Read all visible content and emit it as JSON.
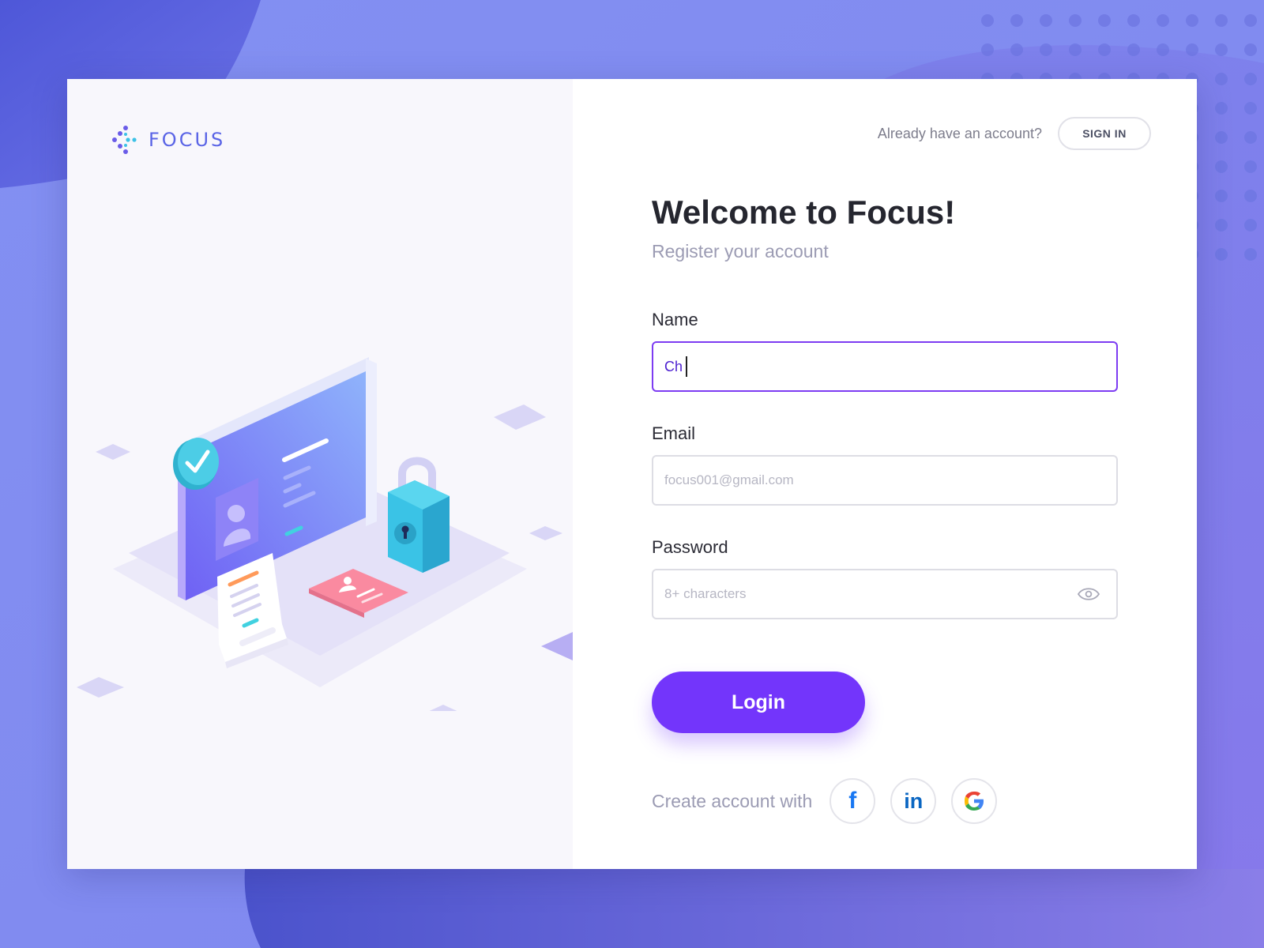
{
  "brand": {
    "name": "FOCUS"
  },
  "header": {
    "already_text": "Already have an account?",
    "signin_label": "SIGN IN"
  },
  "form": {
    "title": "Welcome to Focus!",
    "subtitle": "Register your account",
    "name_label": "Name",
    "name_value": "Ch",
    "email_label": "Email",
    "email_placeholder": "focus001@gmail.com",
    "password_label": "Password",
    "password_placeholder": "8+ characters",
    "login_label": "Login"
  },
  "social": {
    "prompt": "Create account with",
    "providers": [
      {
        "icon": "facebook-icon",
        "glyph": "f",
        "color": "#1877f2"
      },
      {
        "icon": "linkedin-icon",
        "glyph": "in",
        "color": "#0a66c2"
      },
      {
        "icon": "google-icon",
        "glyph": "G",
        "color": "#4285f4"
      }
    ]
  },
  "colors": {
    "accent": "#7335fb",
    "brand": "#5a64e6",
    "background": "#7d88ef"
  }
}
